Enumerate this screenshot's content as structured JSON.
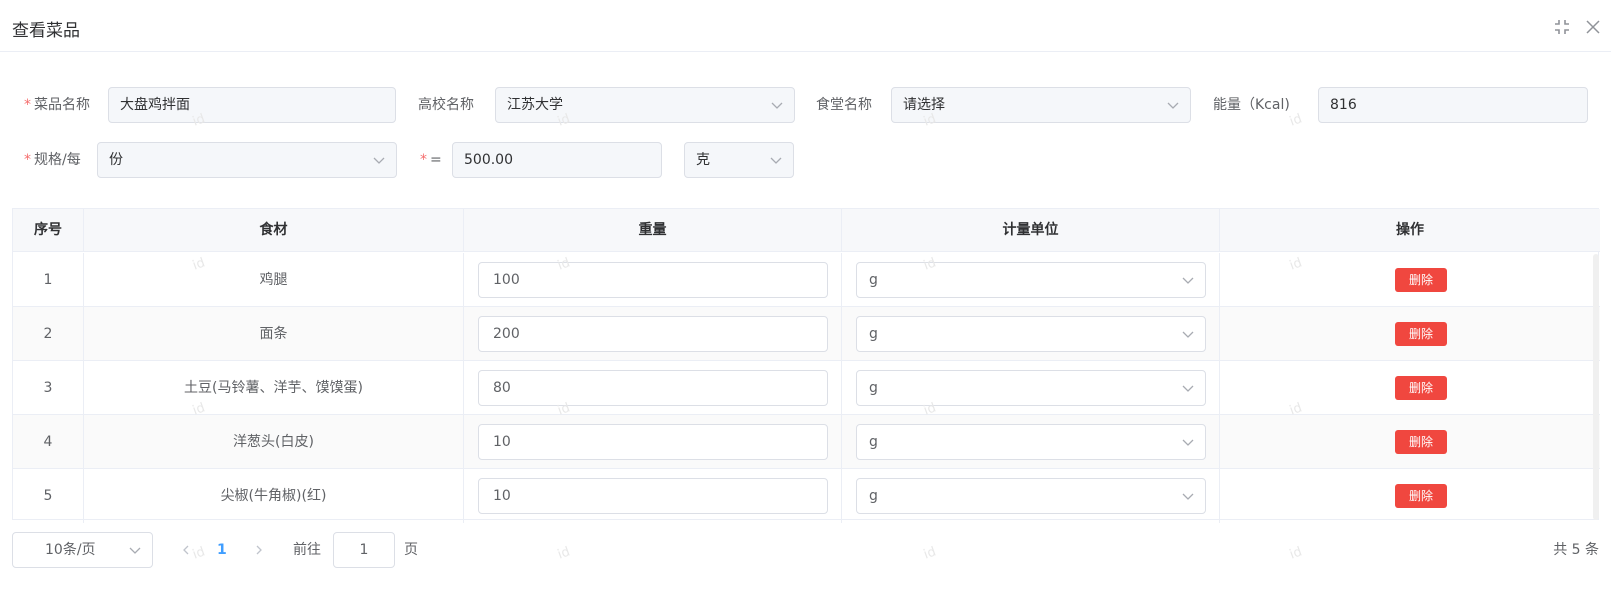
{
  "dialog": {
    "title": "查看菜品"
  },
  "form": {
    "dish_name_label": "菜品名称",
    "dish_name_value": "大盘鸡拌面",
    "school_label": "高校名称",
    "school_value": "江苏大学",
    "canteen_label": "食堂名称",
    "canteen_placeholder": "请选择",
    "energy_label": "能量（Kcal)",
    "energy_value": "816",
    "spec_label": "规格/每",
    "spec_value": "份",
    "equals_label": "=",
    "amount_value": "500.00",
    "unit_value": "克",
    "required_mark": "*"
  },
  "table": {
    "columns": [
      "序号",
      "食材",
      "重量",
      "计量单位",
      "操作"
    ],
    "delete_label": "删除",
    "rows": [
      {
        "index": "1",
        "ingredient": "鸡腿",
        "weight": "100",
        "unit": "g"
      },
      {
        "index": "2",
        "ingredient": "面条",
        "weight": "200",
        "unit": "g"
      },
      {
        "index": "3",
        "ingredient": "土豆(马铃薯、洋芋、馍馍蛋)",
        "weight": "80",
        "unit": "g"
      },
      {
        "index": "4",
        "ingredient": "洋葱头(白皮)",
        "weight": "10",
        "unit": "g"
      },
      {
        "index": "5",
        "ingredient": "尖椒(牛角椒)(红)",
        "weight": "10",
        "unit": "g"
      }
    ]
  },
  "pagination": {
    "page_size": "10条/页",
    "current_page": "1",
    "goto_label": "前往",
    "goto_value": "1",
    "page_suffix": "页",
    "total": "共 5 条"
  },
  "watermark": "id"
}
